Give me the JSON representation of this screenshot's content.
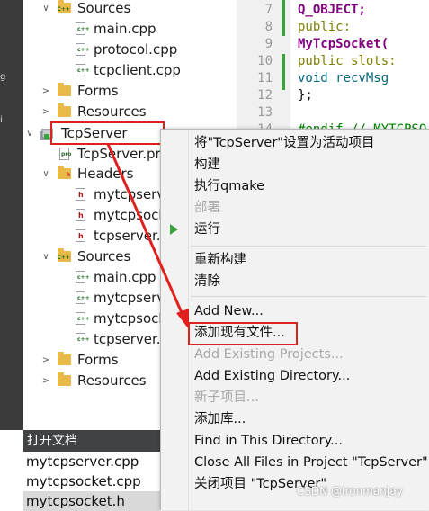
{
  "left_bar": {
    "fragments": [
      "g",
      "i"
    ]
  },
  "tree": {
    "items": [
      {
        "label": "Sources",
        "kind": "folder-sources",
        "expanded": true
      },
      {
        "label": "main.cpp",
        "kind": "cpp"
      },
      {
        "label": "protocol.cpp",
        "kind": "cpp"
      },
      {
        "label": "tcpclient.cpp",
        "kind": "cpp"
      },
      {
        "label": "Forms",
        "kind": "folder-forms",
        "expanded": false
      },
      {
        "label": "Resources",
        "kind": "folder-resources",
        "expanded": false
      },
      {
        "label": "TcpServer",
        "kind": "project",
        "expanded": true
      },
      {
        "label": "TcpServer.pr",
        "kind": "pro"
      },
      {
        "label": "Headers",
        "kind": "folder-headers",
        "expanded": true
      },
      {
        "label": "mytcpserv",
        "kind": "h"
      },
      {
        "label": "mytcpsock",
        "kind": "h"
      },
      {
        "label": "tcpserver.h",
        "kind": "h"
      },
      {
        "label": "Sources",
        "kind": "folder-sources",
        "expanded": true
      },
      {
        "label": "main.cpp",
        "kind": "cpp"
      },
      {
        "label": "mytcpserv",
        "kind": "cpp"
      },
      {
        "label": "mytcpsock",
        "kind": "cpp"
      },
      {
        "label": "tcpserver.",
        "kind": "cpp"
      },
      {
        "label": "Forms",
        "kind": "folder-forms",
        "expanded": false
      },
      {
        "label": "Resources",
        "kind": "folder-resources",
        "expanded": false
      }
    ]
  },
  "editor": {
    "lines": [
      {
        "num": "7",
        "text": "    Q_OBJECT;"
      },
      {
        "num": "8",
        "text": "public:"
      },
      {
        "num": "9",
        "text": "    MyTcpSocket("
      },
      {
        "num": "10",
        "text": "public slots:"
      },
      {
        "num": "11",
        "text": "    void recvMsg"
      },
      {
        "num": "12",
        "text": "};"
      },
      {
        "num": "13",
        "text": ""
      },
      {
        "num": "14",
        "text": "#endif // MYTCPSO"
      }
    ]
  },
  "context_menu": {
    "items": [
      {
        "label": "将\"TcpServer\"设置为活动项目",
        "enabled": true
      },
      {
        "label": "构建",
        "enabled": true
      },
      {
        "label": "执行qmake",
        "enabled": true
      },
      {
        "label": "部署",
        "enabled": false
      },
      {
        "label": "运行",
        "enabled": true,
        "icon": "run-icon"
      },
      {
        "label": "重新构建",
        "enabled": true
      },
      {
        "label": "清除",
        "enabled": true
      },
      {
        "label": "Add New...",
        "enabled": true
      },
      {
        "label": "添加现有文件...",
        "enabled": true
      },
      {
        "label": "Add Existing Projects...",
        "enabled": false
      },
      {
        "label": "Add Existing Directory...",
        "enabled": true
      },
      {
        "label": "新子项目...",
        "enabled": false
      },
      {
        "label": "添加库...",
        "enabled": true
      },
      {
        "label": "Find in This Directory...",
        "enabled": true
      },
      {
        "label": "Close All Files in Project \"TcpServer\"",
        "enabled": true
      },
      {
        "label": "关闭项目 \"TcpServer\"",
        "enabled": true
      }
    ]
  },
  "open_documents": {
    "header": "打开文档",
    "items": [
      {
        "label": "mytcpserver.cpp",
        "selected": false
      },
      {
        "label": "mytcpsocket.cpp",
        "selected": false
      },
      {
        "label": "mytcpsocket.h",
        "selected": true
      }
    ]
  },
  "watermark": "CSDN @IronmanJay",
  "colors": {
    "highlight": "#e0201c",
    "sidebar": "#3b3b3b",
    "menu_bg": "#f2f2f2",
    "keyword": "#808000",
    "class": "#800080",
    "comment": "#008000"
  }
}
